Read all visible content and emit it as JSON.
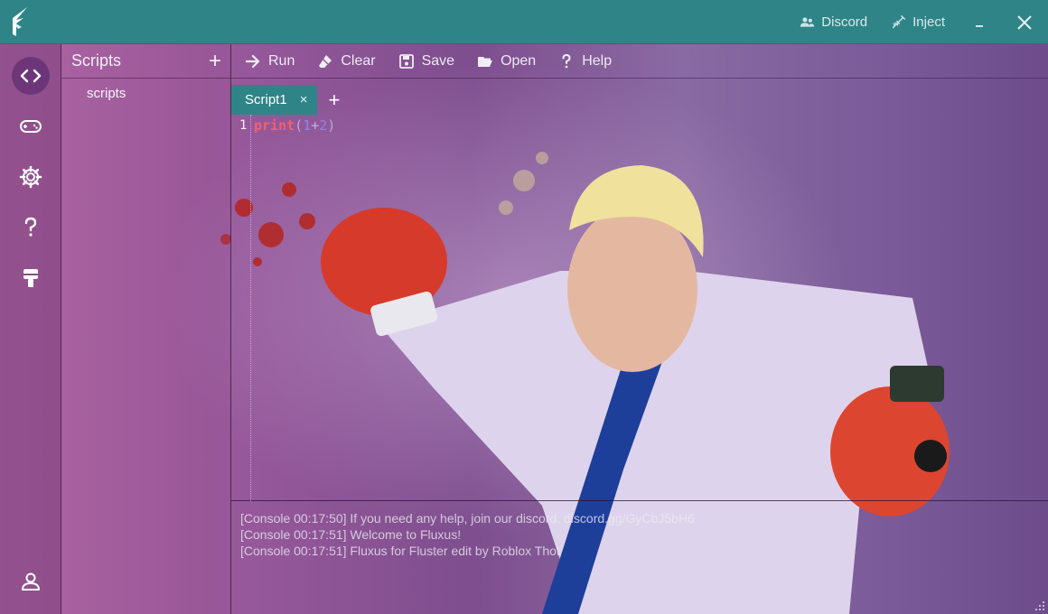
{
  "titlebar": {
    "discord_label": "Discord",
    "inject_label": "Inject",
    "minimize_icon": "minimize-icon",
    "close_icon": "close-icon",
    "accent": "#2f8487"
  },
  "rail": {
    "items": [
      {
        "name": "code-icon",
        "active": true
      },
      {
        "name": "gamepad-icon",
        "active": false
      },
      {
        "name": "gear-icon",
        "active": false
      },
      {
        "name": "help-icon",
        "active": false
      },
      {
        "name": "paint-brush-icon",
        "active": false
      },
      {
        "name": "user-icon",
        "active": false
      }
    ]
  },
  "scripts_panel": {
    "title": "Scripts",
    "add_label": "+",
    "items": [
      "scripts"
    ]
  },
  "toolbar": {
    "run_label": "Run",
    "clear_label": "Clear",
    "save_label": "Save",
    "open_label": "Open",
    "help_label": "Help"
  },
  "tabs": [
    {
      "label": "Script1",
      "close": "×"
    }
  ],
  "tab_add_label": "+",
  "editor": {
    "line_number": "1",
    "code": {
      "fn": "print",
      "open": "(",
      "a": "1",
      "op": "+",
      "b": "2",
      "close": ")"
    }
  },
  "console": {
    "lines": [
      "[Console 00:17:50] If you need any help, join our discord: discord.gg/GyCbJ5bH6",
      "[Console 00:17:51] Welcome to Fluxus!",
      "[Console 00:17:51] Fluxus for Fluster edit by Roblox Thot"
    ]
  }
}
